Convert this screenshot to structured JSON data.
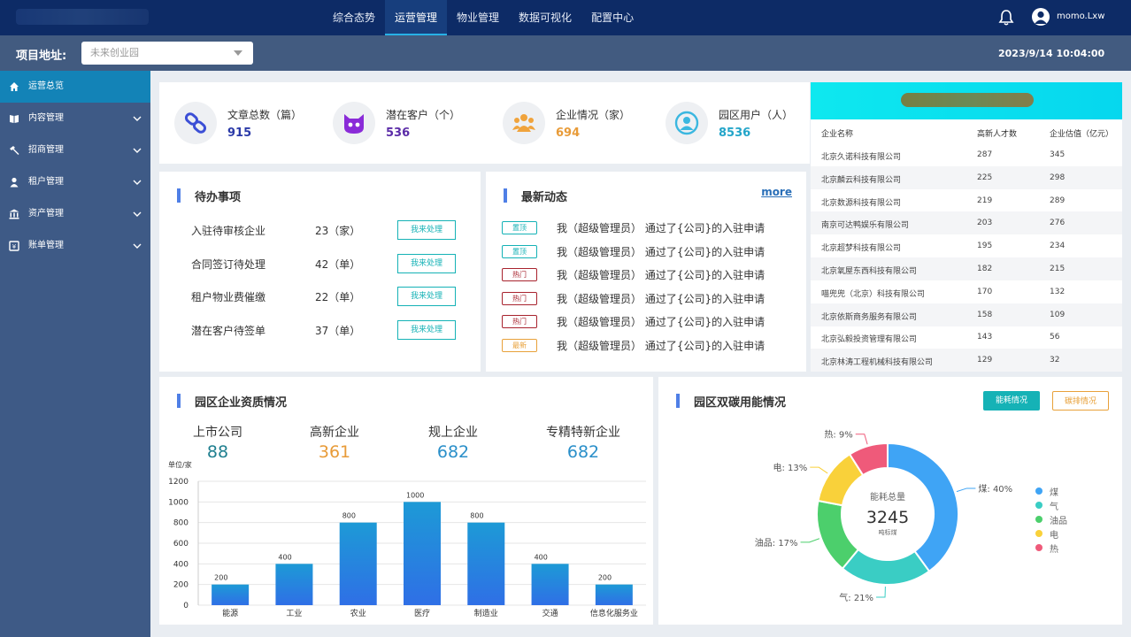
{
  "nav": {
    "items": [
      "综合态势",
      "运营管理",
      "物业管理",
      "数据可视化",
      "配置中心"
    ],
    "active": 1,
    "username": "momo.Lxw"
  },
  "project": {
    "label": "项目地址:",
    "select_value": "未来创业园",
    "datetime": "2023/9/14 10:04:00"
  },
  "sidebar": {
    "items": [
      {
        "label": "运营总览",
        "icon": "home-icon"
      },
      {
        "label": "内容管理",
        "icon": "book-icon"
      },
      {
        "label": "招商管理",
        "icon": "hammer-icon"
      },
      {
        "label": "租户管理",
        "icon": "user-icon"
      },
      {
        "label": "资产管理",
        "icon": "bank-icon"
      },
      {
        "label": "账单管理",
        "icon": "bill-icon"
      }
    ]
  },
  "stats": [
    {
      "label": "文章总数（篇）",
      "value": "915",
      "color": "#2b3aa8",
      "icon": "link-icon"
    },
    {
      "label": "潜在客户（个）",
      "value": "536",
      "color": "#5b2ca8",
      "icon": "cat-icon"
    },
    {
      "label": "企业情况（家）",
      "value": "694",
      "color": "#e89b38",
      "icon": "group-icon"
    },
    {
      "label": "园区用户（人）",
      "value": "8536",
      "color": "#23a5c9",
      "icon": "person-icon"
    }
  ],
  "companies": {
    "headers": [
      "企业名称",
      "高新人才数",
      "企业估值（亿元）"
    ],
    "rows": [
      [
        "北京久诺科技有限公司",
        "287",
        "345"
      ],
      [
        "北京麟云科技有限公司",
        "225",
        "298"
      ],
      [
        "北京数源科技有限公司",
        "219",
        "289"
      ],
      [
        "南京可达鸭娱乐有限公司",
        "203",
        "276"
      ],
      [
        "北京超梦科技有限公司",
        "195",
        "234"
      ],
      [
        "北京氧屋东西科技有限公司",
        "182",
        "215"
      ],
      [
        "喵兜兜（北京）科技有限公司",
        "170",
        "132"
      ],
      [
        "北京依斯商务服务有限公司",
        "158",
        "109"
      ],
      [
        "北京弘毅投资管理有限公司",
        "143",
        "56"
      ],
      [
        "北京林涛工程机械科技有限公司",
        "129",
        "32"
      ]
    ]
  },
  "todo": {
    "title": "待办事项",
    "button_label": "我来处理",
    "items": [
      {
        "name": "入驻待审核企业",
        "count": "23（家）"
      },
      {
        "name": "合同签订待处理",
        "count": "42（单）"
      },
      {
        "name": "租户物业费催缴",
        "count": "22（单）"
      },
      {
        "name": "潜在客户待签单",
        "count": "37（单）"
      }
    ]
  },
  "news": {
    "title": "最新动态",
    "more": "more",
    "items": [
      {
        "tag": "置顶",
        "tag_color": "#15b2b6",
        "text": "我（超级管理员） 通过了{公司}的入驻申请"
      },
      {
        "tag": "置顶",
        "tag_color": "#15b2b6",
        "text": "我（超级管理员） 通过了{公司}的入驻申请"
      },
      {
        "tag": "热门",
        "tag_color": "#a8232e",
        "text": "我（超级管理员） 通过了{公司}的入驻申请"
      },
      {
        "tag": "热门",
        "tag_color": "#a8232e",
        "text": "我（超级管理员） 通过了{公司}的入驻申请"
      },
      {
        "tag": "热门",
        "tag_color": "#a8232e",
        "text": "我（超级管理员） 通过了{公司}的入驻申请"
      },
      {
        "tag": "最新",
        "tag_color": "#e8a13a",
        "text": "我（超级管理员） 通过了{公司}的入驻申请"
      }
    ]
  },
  "qualification": {
    "title": "园区企业资质情况",
    "items": [
      {
        "label": "上市公司",
        "value": "88",
        "color": "#1f7f8f"
      },
      {
        "label": "高新企业",
        "value": "361",
        "color": "#e89b38"
      },
      {
        "label": "规上企业",
        "value": "682",
        "color": "#2a8fc9"
      },
      {
        "label": "专精特新企业",
        "value": "682",
        "color": "#2a8fc9"
      }
    ]
  },
  "energy": {
    "title": "园区双碳用能情况",
    "buttons": [
      "能耗情况",
      "碳排情况"
    ],
    "center_label": "能耗总量",
    "center_value": "3245",
    "center_unit": "吨标煤",
    "colors": {
      "accent": "#15b2b6",
      "outline": "#e8a13a"
    }
  },
  "chart_data": [
    {
      "type": "bar",
      "ylabel": "单位/家",
      "ylim": [
        0,
        1200
      ],
      "yticks": [
        0,
        200,
        400,
        600,
        800,
        1000,
        1200
      ],
      "categories": [
        "能源",
        "工业",
        "农业",
        "医疗",
        "制造业",
        "交通",
        "信息化服务业"
      ],
      "values": [
        200,
        400,
        800,
        1000,
        800,
        400,
        200
      ],
      "color": "#2a8fdc"
    },
    {
      "type": "pie",
      "categories": [
        "煤",
        "气",
        "油品",
        "电",
        "热"
      ],
      "values": [
        40,
        21,
        17,
        13,
        9
      ],
      "slice_labels": [
        "煤: 40%",
        "气: 21%",
        "油品: 17%",
        "电: 13%",
        "热: 9%"
      ],
      "colors": [
        "#3fa4f5",
        "#3acdc4",
        "#4ccf6c",
        "#f9d13a",
        "#ef5a7a"
      ],
      "legend_placement": "right"
    }
  ]
}
